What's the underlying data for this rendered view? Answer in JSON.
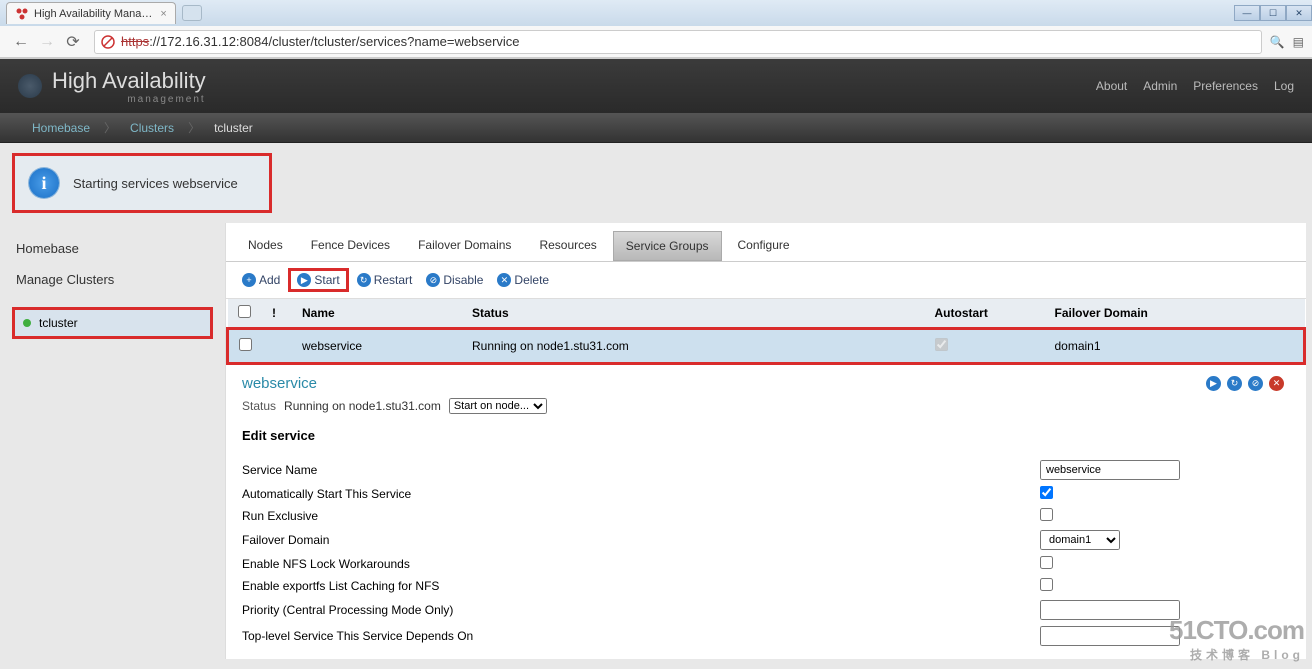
{
  "browser": {
    "tab_title": "High Availability Mana…",
    "url_protocol": "https",
    "url_rest": "://172.16.31.12:8084/cluster/tcluster/services?name=webservice"
  },
  "header": {
    "brand_main": "High Availability",
    "brand_sub": "management",
    "nav": {
      "about": "About",
      "admin": "Admin",
      "prefs": "Preferences",
      "logout": "Log"
    }
  },
  "breadcrumb": {
    "b1": "Homebase",
    "b2": "Clusters",
    "b3": "tcluster"
  },
  "alert": {
    "text": "Starting services webservice"
  },
  "sidebar": {
    "link_homebase": "Homebase",
    "link_manage": "Manage Clusters",
    "item_cluster": "tcluster"
  },
  "tabs": {
    "nodes": "Nodes",
    "fence": "Fence Devices",
    "failover": "Failover Domains",
    "resources": "Resources",
    "service_groups": "Service Groups",
    "configure": "Configure"
  },
  "toolbar": {
    "add": "Add",
    "start": "Start",
    "restart": "Restart",
    "disable": "Disable",
    "delete": "Delete"
  },
  "table": {
    "col_bang": "!",
    "col_name": "Name",
    "col_status": "Status",
    "col_auto": "Autostart",
    "col_failover": "Failover Domain",
    "row": {
      "name": "webservice",
      "status": "Running on node1.stu31.com",
      "failover": "domain1"
    }
  },
  "detail": {
    "title": "webservice",
    "status_label": "Status",
    "status_value": "Running on node1.stu31.com",
    "select_prompt": "Start on node...",
    "edit_heading": "Edit service",
    "fields": {
      "service_name_label": "Service Name",
      "service_name_value": "webservice",
      "auto_start": "Automatically Start This Service",
      "run_exclusive": "Run Exclusive",
      "failover_domain_label": "Failover Domain",
      "failover_domain_value": "domain1",
      "nfs_lock": "Enable NFS Lock Workarounds",
      "exportfs": "Enable exportfs List Caching for NFS",
      "priority": "Priority (Central Processing Mode Only)",
      "top_level": "Top-level Service This Service Depends On"
    }
  },
  "watermark": {
    "main": "51CTO.com",
    "sub": "技术博客   Blog"
  }
}
